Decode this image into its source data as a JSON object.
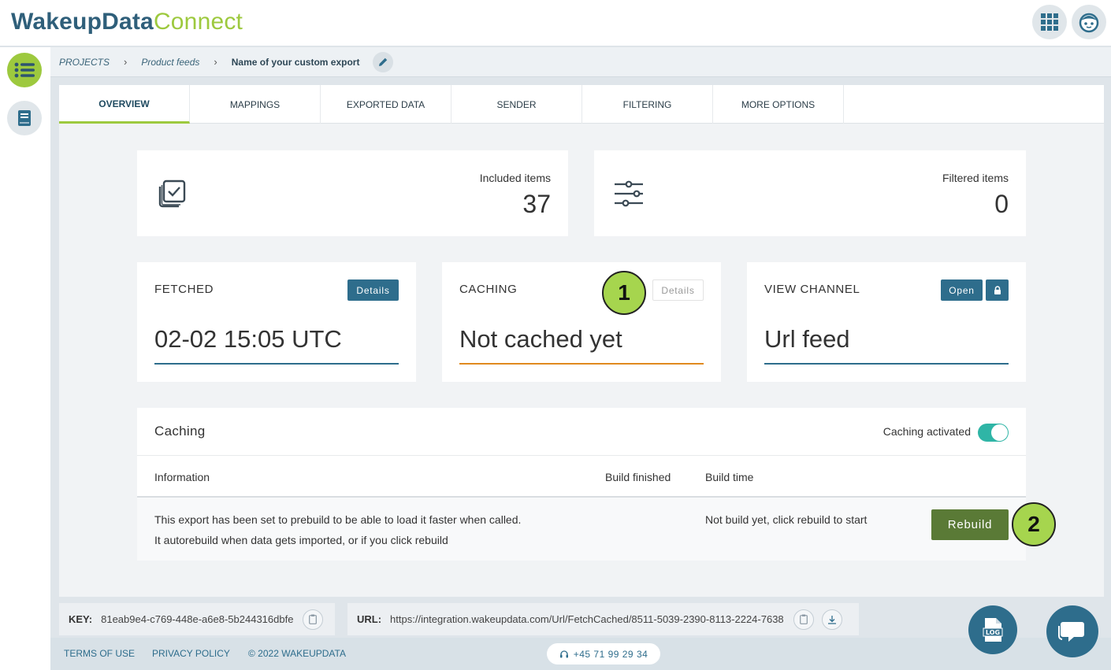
{
  "brand": {
    "word1": "WakeupData",
    "word2": "Connect"
  },
  "header": {
    "apps_icon": "grid-icon",
    "user_icon": "avatar-face-icon"
  },
  "rail": {
    "items": [
      {
        "icon": "list-icon",
        "active": true
      },
      {
        "icon": "book-icon",
        "active": false
      }
    ]
  },
  "breadcrumb": {
    "projects": "PROJECTS",
    "feeds": "Product feeds",
    "current": "Name of your custom export",
    "sep": "›"
  },
  "tabs": [
    "OVERVIEW",
    "MAPPINGS",
    "EXPORTED DATA",
    "SENDER",
    "FILTERING",
    "MORE OPTIONS"
  ],
  "stats": {
    "included": {
      "label": "Included items",
      "value": "37"
    },
    "filtered": {
      "label": "Filtered items",
      "value": "0"
    }
  },
  "boxes": {
    "fetched": {
      "title": "FETCHED",
      "button": "Details",
      "value": "02-02 15:05 UTC",
      "line_color": "#2e6d8c"
    },
    "caching": {
      "title": "CACHING",
      "button": "Details",
      "value": "Not cached yet",
      "line_color": "#e08a1e"
    },
    "channel": {
      "title": "VIEW CHANNEL",
      "button": "Open",
      "value": "Url feed",
      "line_color": "#2e6d8c"
    }
  },
  "markers": {
    "one": "1",
    "two": "2"
  },
  "caching_panel": {
    "title": "Caching",
    "toggle_label": "Caching activated",
    "toggle_on": true,
    "col_information": "Information",
    "col_build_finished": "Build finished",
    "col_build_time": "Build time",
    "info_line1": "This export has been set to prebuild to be able to load it faster when called.",
    "info_line2": "It autorebuild when data gets imported, or if you click rebuild",
    "build_time_value": "Not build yet, click rebuild to start",
    "rebuild_label": "Rebuild"
  },
  "key": {
    "label": "KEY:",
    "value": "81eab9e4-c769-448e-a6e8-5b244316dbfe"
  },
  "url": {
    "label": "URL:",
    "value": "https://integration.wakeupdata.com/Url/FetchCached/8511-5039-2390-8113-2224-7638"
  },
  "footer": {
    "terms": "TERMS OF USE",
    "privacy": "PRIVACY POLICY",
    "copyright": "© 2022 WAKEUPDATA",
    "phone": "+45 71 99 29 34"
  },
  "colors": {
    "brand_green": "#9dc93e",
    "brand_blue": "#2e6d8c",
    "rebuild_green": "#5a7a36",
    "toggle_teal": "#2fb5a6",
    "marker_green": "#a6d54e"
  }
}
